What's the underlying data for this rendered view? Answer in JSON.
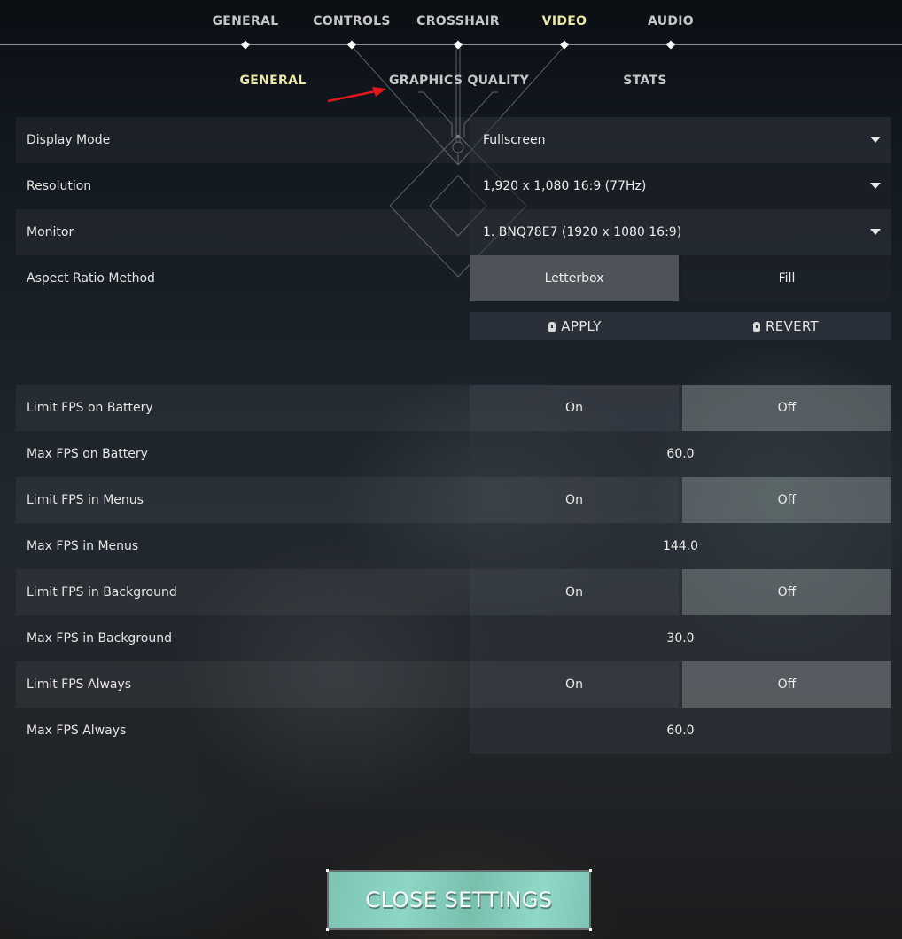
{
  "top_tabs": [
    {
      "label": "GENERAL",
      "active": false
    },
    {
      "label": "CONTROLS",
      "active": false
    },
    {
      "label": "CROSSHAIR",
      "active": false
    },
    {
      "label": "VIDEO",
      "active": true
    },
    {
      "label": "AUDIO",
      "active": false
    }
  ],
  "sub_tabs": [
    {
      "label": "GENERAL",
      "active": true
    },
    {
      "label": "GRAPHICS QUALITY",
      "active": false
    },
    {
      "label": "STATS",
      "active": false
    }
  ],
  "display_settings": {
    "display_mode": {
      "label": "Display Mode",
      "value": "Fullscreen",
      "icon": "chevron-down-icon"
    },
    "resolution": {
      "label": "Resolution",
      "value": "1,920 x 1,080 16:9 (77Hz)",
      "icon": "chevron-down-icon"
    },
    "monitor": {
      "label": "Monitor",
      "value": "1. BNQ78E7 (1920 x  1080 16:9)",
      "icon": "chevron-down-icon"
    },
    "aspect_ratio": {
      "label": "Aspect Ratio Method",
      "options": [
        "Letterbox",
        "Fill"
      ],
      "selected": "Letterbox"
    }
  },
  "apply_bar": {
    "apply_label": "APPLY",
    "revert_label": "REVERT",
    "icon": "lock-icon"
  },
  "fps_settings": [
    {
      "label": "Limit FPS on Battery",
      "type": "toggle",
      "on_label": "On",
      "off_label": "Off",
      "selected": "Off"
    },
    {
      "label": "Max FPS on Battery",
      "type": "value",
      "value": "60.0"
    },
    {
      "label": "Limit FPS in Menus",
      "type": "toggle",
      "on_label": "On",
      "off_label": "Off",
      "selected": "Off"
    },
    {
      "label": "Max FPS in Menus",
      "type": "value",
      "value": "144.0"
    },
    {
      "label": "Limit FPS in Background",
      "type": "toggle",
      "on_label": "On",
      "off_label": "Off",
      "selected": "Off"
    },
    {
      "label": "Max FPS in Background",
      "type": "value",
      "value": "30.0"
    },
    {
      "label": "Limit FPS Always",
      "type": "toggle",
      "on_label": "On",
      "off_label": "Off",
      "selected": "Off"
    },
    {
      "label": "Max FPS Always",
      "type": "value",
      "value": "60.0"
    }
  ],
  "close_button": {
    "label": "CLOSE SETTINGS"
  },
  "colors": {
    "active_tab": "#ece8a6",
    "inactive_tab": "#c4c6c8",
    "close_button": "#8dd6c6",
    "annotation_arrow": "#e01818"
  }
}
